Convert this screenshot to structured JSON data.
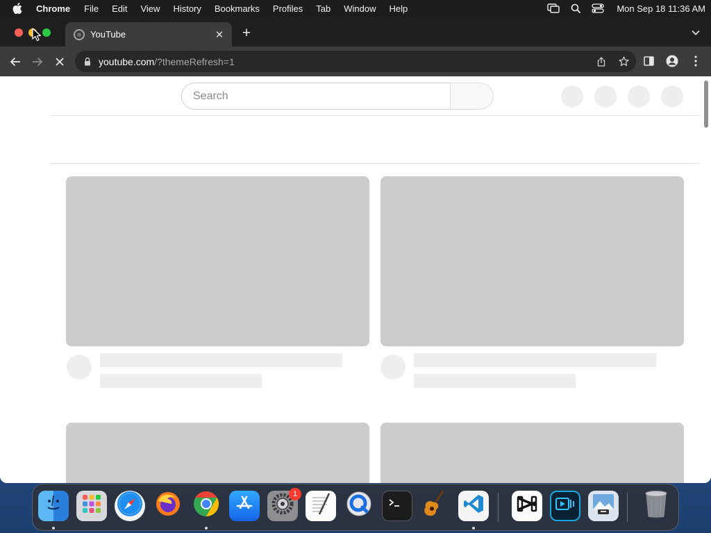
{
  "menubar": {
    "app_name": "Chrome",
    "items": [
      "File",
      "Edit",
      "View",
      "History",
      "Bookmarks",
      "Profiles",
      "Tab",
      "Window",
      "Help"
    ],
    "clock": "Mon Sep 18  11:36 AM"
  },
  "browser": {
    "tab": {
      "title": "YouTube",
      "favicon": "loading-spinner-icon"
    },
    "address": {
      "host": "youtube.com",
      "path": "/?themeRefresh=1"
    }
  },
  "page": {
    "search": {
      "placeholder": "Search"
    }
  },
  "dock": {
    "apps": [
      {
        "name": "finder",
        "icon": "finder-icon",
        "running": true
      },
      {
        "name": "launchpad",
        "icon": "launchpad-icon",
        "running": false
      },
      {
        "name": "safari",
        "icon": "safari-icon",
        "running": false
      },
      {
        "name": "firefox",
        "icon": "firefox-icon",
        "running": false
      },
      {
        "name": "chrome",
        "icon": "chrome-icon",
        "running": true
      },
      {
        "name": "app-store",
        "icon": "app-store-icon",
        "running": false
      },
      {
        "name": "system-settings",
        "icon": "gear-icon",
        "running": false,
        "badge": "1"
      },
      {
        "name": "textedit",
        "icon": "textedit-icon",
        "running": false
      },
      {
        "name": "quicktime",
        "icon": "quicktime-icon",
        "running": false
      },
      {
        "name": "terminal",
        "icon": "terminal-icon",
        "running": false
      },
      {
        "name": "garageband",
        "icon": "guitar-icon",
        "running": false
      },
      {
        "name": "vscode",
        "icon": "vscode-icon",
        "running": true
      },
      {
        "name": "capcut",
        "icon": "capcut-icon",
        "running": false
      },
      {
        "name": "screen-recorder",
        "icon": "screen-recorder-icon",
        "running": false
      },
      {
        "name": "preview",
        "icon": "preview-icon",
        "running": false
      },
      {
        "name": "trash",
        "icon": "trash-icon",
        "running": false
      }
    ]
  },
  "colors": {
    "menubar_bg": "#1d1d1f",
    "tabstrip_bg": "#1f1f1f",
    "toolbar_bg": "#3c3c3c",
    "skeleton_thumb": "#cccccc",
    "skeleton_line": "#eeeeee"
  }
}
